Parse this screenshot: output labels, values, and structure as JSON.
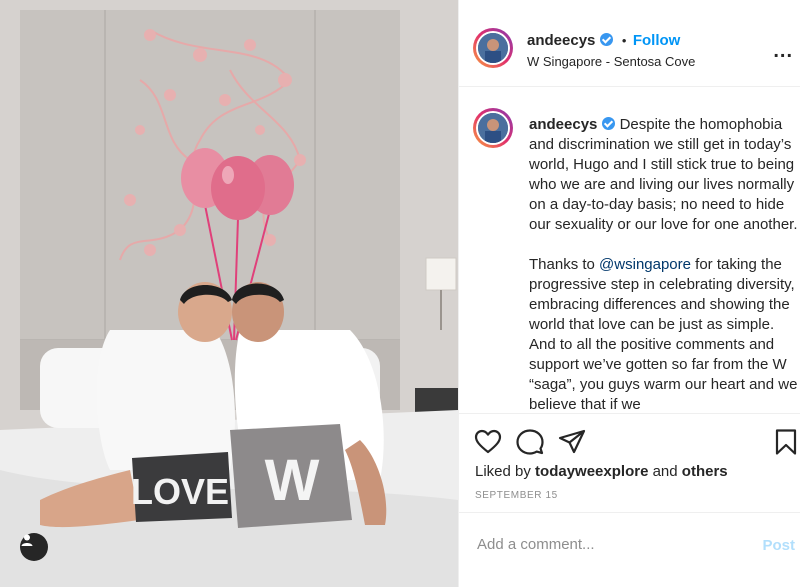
{
  "post": {
    "username": "andeecys",
    "dot": "•",
    "follow_label": "Follow",
    "location": "W Singapore - Sentosa Cove",
    "more_label": "..."
  },
  "caption": {
    "username": "andeecys",
    "p1": "Despite the homophobia and discrimination we still get in today’s world, Hugo and I still stick true to being who we are and living our lives normally on a day-to-day basis; no need to hide our sexuality or our love for one another.",
    "p2_before": "Thanks to ",
    "p2_mention": "@wsingapore",
    "p2_after": " for taking the progressive step in celebrating diversity, embracing differences and showing the world that love can be just as simple. And to all the positive comments and support we’ve gotten so far from the W “saga”, you guys warm our heart and we believe that if we"
  },
  "actions": {
    "like_icon": "heart-icon",
    "comment_icon": "comment-icon",
    "share_icon": "share-icon",
    "save_icon": "bookmark-icon"
  },
  "likes": {
    "prefix": "Liked by",
    "user": "todayweexplore",
    "middle": "and",
    "others": "others"
  },
  "date": "SEPTEMBER 15",
  "comment_box": {
    "placeholder": "Add a comment...",
    "post_label": "Post"
  },
  "photo": {
    "pillow_left": "LOVE",
    "pillow_right": "W",
    "tag_icon": "user-tag-icon"
  },
  "colors": {
    "accent": "#0095f6",
    "verified": "#3897f0",
    "post_disabled": "#b2dffc"
  }
}
